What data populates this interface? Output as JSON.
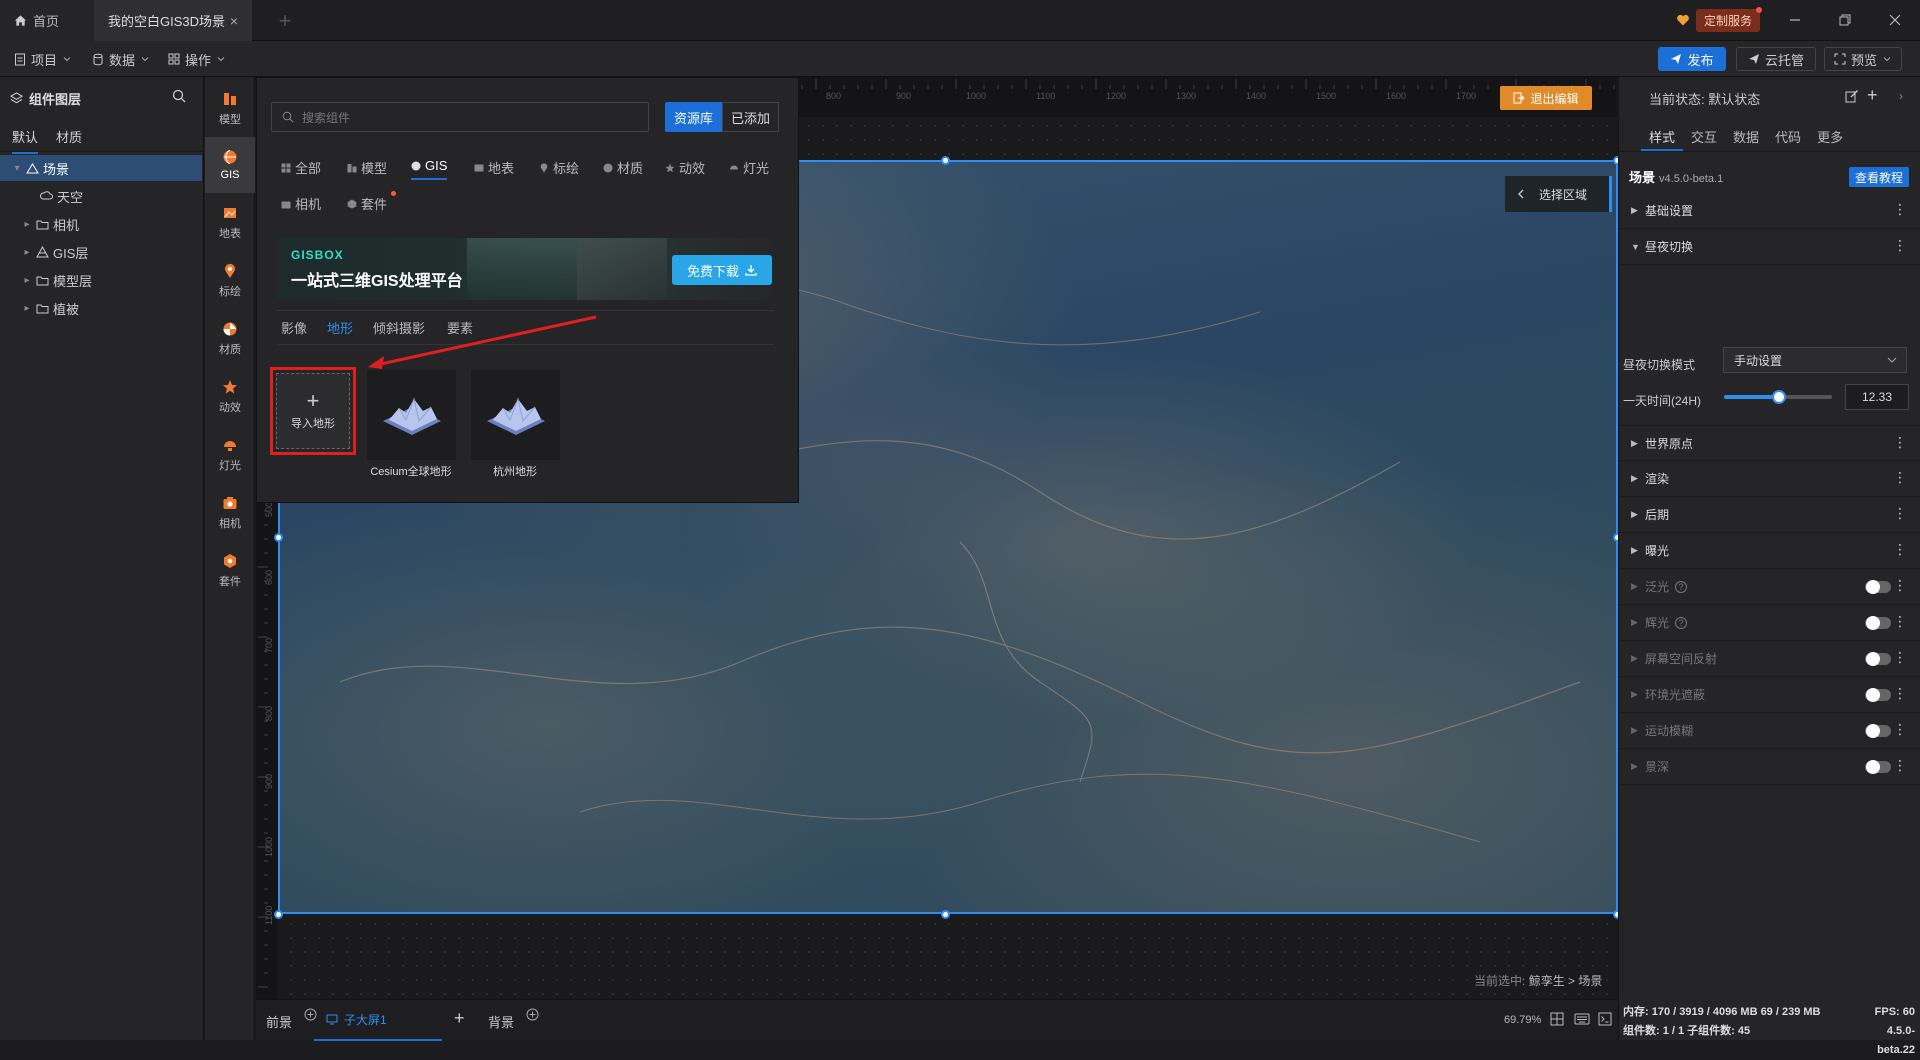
{
  "tabs": {
    "home": "首页",
    "scene": "我的空白GIS3D场景",
    "close": "×",
    "add": "+"
  },
  "custom_service": "定制服务",
  "menubar": {
    "project": "项目",
    "data": "数据",
    "operation": "操作",
    "publish": "发布",
    "cloud": "云托管",
    "preview": "预览"
  },
  "layers": {
    "title": "组件图层",
    "tabs": [
      "默认",
      "材质"
    ],
    "items": [
      "场景",
      "天空",
      "相机",
      "GIS层",
      "模型层",
      "植被"
    ]
  },
  "icon_column": [
    "模型",
    "GIS",
    "地表",
    "标绘",
    "材质",
    "动效",
    "灯光",
    "相机",
    "套件"
  ],
  "popup": {
    "search_placeholder": "搜索组件",
    "library": "资源库",
    "added": "已添加",
    "categories": [
      "全部",
      "模型",
      "GIS",
      "地表",
      "标绘",
      "材质",
      "动效",
      "灯光",
      "相机",
      "套件"
    ],
    "banner_logo": "GISBOX",
    "banner_slogan": "一站式三维GIS处理平台",
    "banner_download": "免费下载",
    "subtabs": [
      "影像",
      "地形",
      "倾斜摄影",
      "要素"
    ],
    "import_label": "导入地形",
    "terrains": [
      "Cesium全球地形",
      "杭州地形"
    ]
  },
  "canvas": {
    "exit_edit": "退出编辑",
    "select_area": "选择区域",
    "current_select_prefix": "当前选中:",
    "current_select_path": "鲸孪生 > 场景",
    "ruler_top": [
      "800",
      "900",
      "1000",
      "1100",
      "1200",
      "1300",
      "1400",
      "1500",
      "1600",
      "1700",
      "1800"
    ],
    "ruler_left": [
      "500",
      "600",
      "700",
      "800",
      "900",
      "1000",
      "1100"
    ]
  },
  "bottombar": {
    "front": "前景",
    "sub_screen": "子大屏1",
    "add": "+",
    "background": "背景",
    "zoom": "69.79%"
  },
  "right_panel": {
    "state_label": "当前状态: 默认状态",
    "tabs": [
      "样式",
      "交互",
      "数据",
      "代码",
      "更多"
    ],
    "scene_title": "场景",
    "scene_version": "v4.5.0-beta.1",
    "tutorial": "查看教程",
    "sections_top": [
      "基础设置",
      "昼夜切换"
    ],
    "daynight_mode_label": "昼夜切换模式",
    "daynight_mode_value": "手动设置",
    "day_time_label": "一天时间(24H)",
    "day_time_value": "12.33",
    "day_time_fraction": 0.51,
    "sections_mid": [
      "世界原点",
      "渲染",
      "后期",
      "曝光"
    ],
    "sections_toggle": [
      "泛光",
      "辉光",
      "屏幕空间反射",
      "环境光遮蔽",
      "运动模糊",
      "景深"
    ],
    "status_line1": "内存: 170 / 3919 / 4096 MB 69 / 239 MB",
    "status_line2": "组件数: 1 / 1   子组件数: 45",
    "fps": "FPS: 60",
    "version": "4.5.0-beta.22"
  },
  "colors": {
    "accent": "#1b6fd6",
    "highlight_border": "#e02020",
    "exit_edit": "#e08a2a"
  }
}
